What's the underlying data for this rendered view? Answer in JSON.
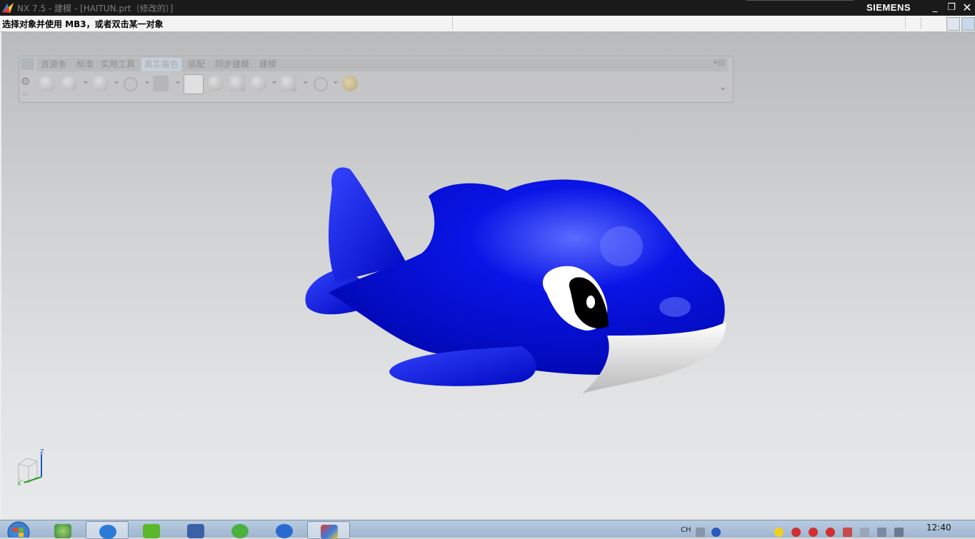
{
  "window": {
    "title": "NX 7.5 - 建模 - [HAITUN.prt（修改的）]",
    "brand": "SIEMENS",
    "controls": [
      "_",
      "❐",
      "✕"
    ]
  },
  "cue_line": {
    "text": "选择对象并使用 MB3，或者双击某一对象"
  },
  "toolbar": {
    "tabs": [
      {
        "label": "资源条",
        "active": false
      },
      {
        "label": "标准",
        "active": false
      },
      {
        "label": "实用工具",
        "active": false
      },
      {
        "label": "真实着色",
        "active": true
      },
      {
        "label": "装配",
        "active": false
      },
      {
        "label": "同步建模",
        "active": false
      },
      {
        "label": "建模",
        "active": false
      }
    ],
    "gear_icon": "gear-icon"
  },
  "model": {
    "name": "dolphin-model",
    "colors": {
      "body": "#0a14e6",
      "belly": "#f2f2f2",
      "eye_white": "#ffffff",
      "pupil": "#000000"
    }
  },
  "triad": {
    "z_label": "Z",
    "x_label": "X"
  },
  "taskbar": {
    "clock": "12:40",
    "lang": "CH",
    "apps": [
      {
        "icon": "windows-explorer-icon",
        "active": false
      },
      {
        "icon": "kugou-icon",
        "active": true
      },
      {
        "icon": "iqiyi-icon",
        "active": false
      },
      {
        "icon": "film-icon",
        "active": false
      },
      {
        "icon": "refresh-icon",
        "active": false
      },
      {
        "icon": "media-player-icon",
        "active": false
      },
      {
        "icon": "nx-icon",
        "active": true
      }
    ]
  }
}
